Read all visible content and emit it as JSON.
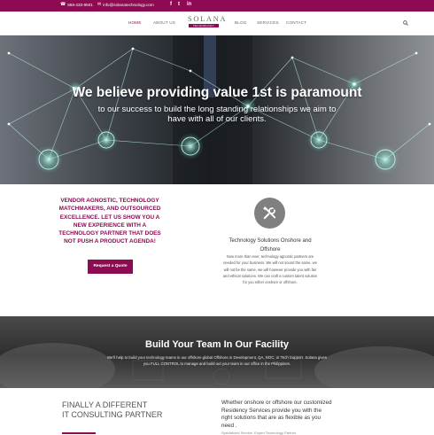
{
  "topbar": {
    "phone": "858-433-9501",
    "email": "info@solanatechnology.com",
    "icons": [
      "phone-icon",
      "envelope-icon",
      "facebook-icon",
      "twitter-icon",
      "linkedin-icon"
    ],
    "facebook": "f",
    "twitter": "t",
    "linkedin": "in"
  },
  "nav": {
    "home": "HOME",
    "about": "ABOUT US",
    "blog": "BLOG",
    "services": "SERVICES",
    "contact": "CONTACT",
    "active": "HOME"
  },
  "logo": {
    "word": "SOLANA",
    "tag": "TECHNOLOGY"
  },
  "hero": {
    "title": "We believe providing value 1st is paramount",
    "subtitle": "to our success to build the long standing relationships we aim to have with all of our clients."
  },
  "intro": {
    "text": "VENDOR AGNOSTIC, TECHNOLOGY MATCHMAKERS, AND OUTSOURCED EXCELLENCE. LET US SHOW YOU A NEW EXPERIENCE WITH A TECHNOLOGY PARTNER THAT DOES NOT PUSH A PRODUCT AGENDA!",
    "button": "Request a Quote"
  },
  "service": {
    "icon": "tools-icon",
    "title": "Technology Solutions Onshore and Offshore",
    "body": "Now more than ever, technology agnostic partners are needed for your business. We will not sound the same, we will not be the same, we will however provide you with fair and ethical solutions. We can craft a custom talent solution for you either onshore or offshore."
  },
  "band": {
    "title": "Build Your Team In Our Facility",
    "body": "We'll help to build your technology teams in our offshore global Offshore in Development, QA, NOC, or Tech Support. Solana gives you FULL CONTROL to manage and build out your team in our office in the Philippines."
  },
  "bottom": {
    "heading_line1": "FINALLY A DIFFERENT",
    "heading_line2": "IT CONSULTING PARTNER",
    "right_text": "Whether onshore or offshore our customized Residency Services provide you with the right solutions that are as flexible as you need .",
    "right_sub": "Specialized Service. Expert Technology Partner"
  },
  "colors": {
    "brand": "#8e0a52"
  }
}
